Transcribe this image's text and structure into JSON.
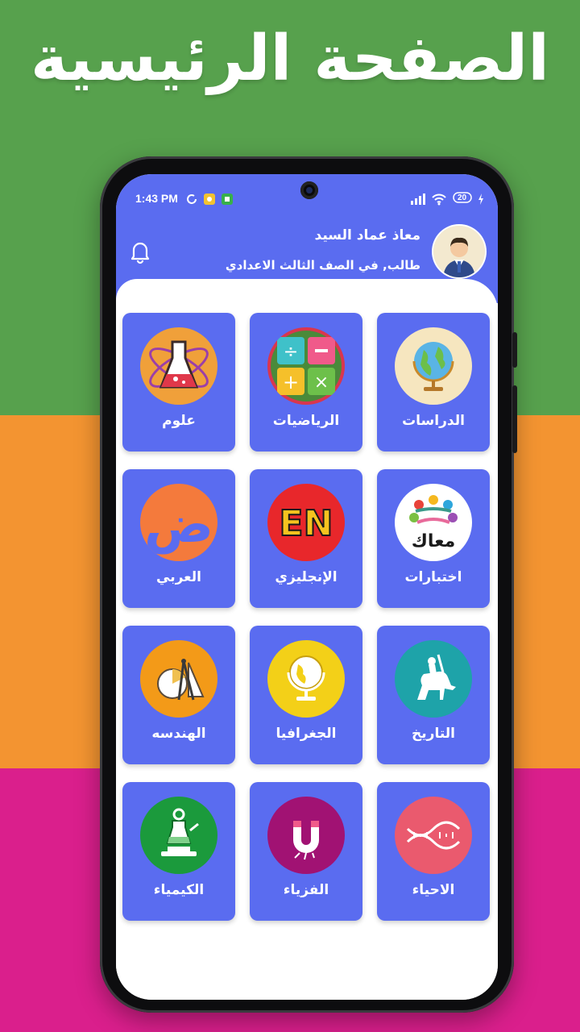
{
  "banner": {
    "title": "الصفحة الرئيسية",
    "colors": {
      "green": "#57a14d",
      "orange": "#f39431",
      "pink": "#da1f8c"
    }
  },
  "status_bar": {
    "time": "1:43 PM",
    "battery": "20",
    "icons": [
      "sync-icon",
      "notification-app-icon",
      "notification-app-icon",
      "signal-icon",
      "wifi-icon",
      "battery-icon",
      "charging-icon"
    ]
  },
  "header": {
    "user_name": "معاذ عماد السيد",
    "user_subtitle": "طالب, في الصف الثالث الاعدادي",
    "accent_color": "#5a6cf0",
    "notification_icon": "bell-icon"
  },
  "subjects": [
    {
      "label": "الدراسات",
      "icon": "globe-icon",
      "icon_bg": "#f6e6bf"
    },
    {
      "label": "الرياضيات",
      "icon": "math-operations-icon",
      "icon_bg": "#4a8a3a"
    },
    {
      "label": "علوم",
      "icon": "science-flask-icon",
      "icon_bg": "#f0a03a"
    },
    {
      "label": "اختبارات",
      "icon": "community-icon",
      "icon_bg": "#ffffff",
      "icon_text": "معاك"
    },
    {
      "label": "الإنجليزي",
      "icon": "english-icon",
      "icon_bg": "#e8272b",
      "icon_text": "EN"
    },
    {
      "label": "العربي",
      "icon": "arabic-letter-icon",
      "icon_bg": "#f47a3c",
      "icon_text": "ض"
    },
    {
      "label": "التاريخ",
      "icon": "history-horseman-icon",
      "icon_bg": "#1ea3a9"
    },
    {
      "label": "الجغرافيا",
      "icon": "geography-globe-icon",
      "icon_bg": "#f3d018"
    },
    {
      "label": "الهندسه",
      "icon": "geometry-tools-icon",
      "icon_bg": "#f39a18"
    },
    {
      "label": "الاحياء",
      "icon": "dna-icon",
      "icon_bg": "#ea5a6e"
    },
    {
      "label": "الفزياء",
      "icon": "magnet-icon",
      "icon_bg": "#a11273"
    },
    {
      "label": "الكيمياء",
      "icon": "chemistry-scale-icon",
      "icon_bg": "#1b9a3c"
    }
  ]
}
